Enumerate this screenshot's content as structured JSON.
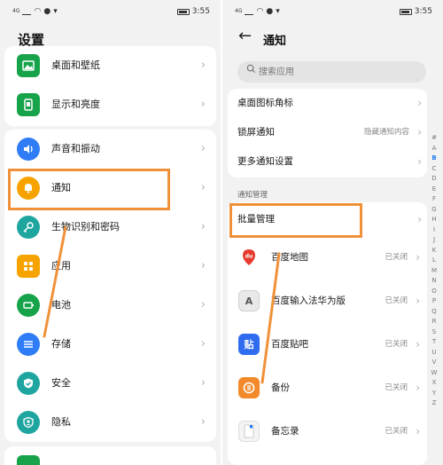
{
  "status_bar": {
    "signal": "4G",
    "time": "3:55"
  },
  "colors": {
    "accent": "#1e7cf0",
    "highlight": "#f0913a"
  },
  "settings": {
    "title": "设置",
    "items": [
      {
        "label": "桌面和壁纸",
        "icon": "wallpaper-icon",
        "color": "#17a34a"
      },
      {
        "label": "显示和亮度",
        "icon": "display-icon",
        "color": "#17a34a"
      },
      {
        "label": "声音和振动",
        "icon": "speaker-icon",
        "color": "#2f7df6"
      },
      {
        "label": "通知",
        "icon": "bell-icon",
        "color": "#f6a300"
      },
      {
        "label": "生物识别和密码",
        "icon": "key-icon",
        "color": "#1fa5a0"
      },
      {
        "label": "应用",
        "icon": "apps-grid-icon",
        "color": "#f6a300"
      },
      {
        "label": "电池",
        "icon": "battery-icon",
        "color": "#17a34a"
      },
      {
        "label": "存储",
        "icon": "storage-icon",
        "color": "#2f7df6"
      },
      {
        "label": "安全",
        "icon": "shield-icon",
        "color": "#1fa5a0"
      },
      {
        "label": "隐私",
        "icon": "privacy-icon",
        "color": "#1fa5a0"
      }
    ]
  },
  "notifications": {
    "title": "通知",
    "search_placeholder": "搜索应用",
    "rows": [
      {
        "label": "桌面图标角标",
        "value": ""
      },
      {
        "label": "锁屏通知",
        "value": "隐藏通知内容"
      },
      {
        "label": "更多通知设置",
        "value": ""
      }
    ],
    "section_header": "通知管理",
    "batch_label": "批量管理",
    "apps": [
      {
        "name": "百度地图",
        "status": "已关闭",
        "icon": "baidu-map-icon",
        "glyph": "du"
      },
      {
        "name": "百度输入法华为版",
        "status": "已关闭",
        "icon": "baidu-input-icon",
        "glyph": "A"
      },
      {
        "name": "百度贴吧",
        "status": "已关闭",
        "icon": "tieba-icon",
        "glyph": "贴"
      },
      {
        "name": "备份",
        "status": "已关闭",
        "icon": "backup-icon",
        "glyph": ""
      },
      {
        "name": "备忘录",
        "status": "已关闭",
        "icon": "memo-icon",
        "glyph": ""
      }
    ],
    "alpha_index": [
      "#",
      "A",
      "B",
      "C",
      "D",
      "E",
      "F",
      "G",
      "H",
      "I",
      "J",
      "K",
      "L",
      "M",
      "N",
      "O",
      "P",
      "Q",
      "R",
      "S",
      "T",
      "U",
      "V",
      "W",
      "X",
      "Y",
      "Z"
    ],
    "alpha_active": "B"
  }
}
